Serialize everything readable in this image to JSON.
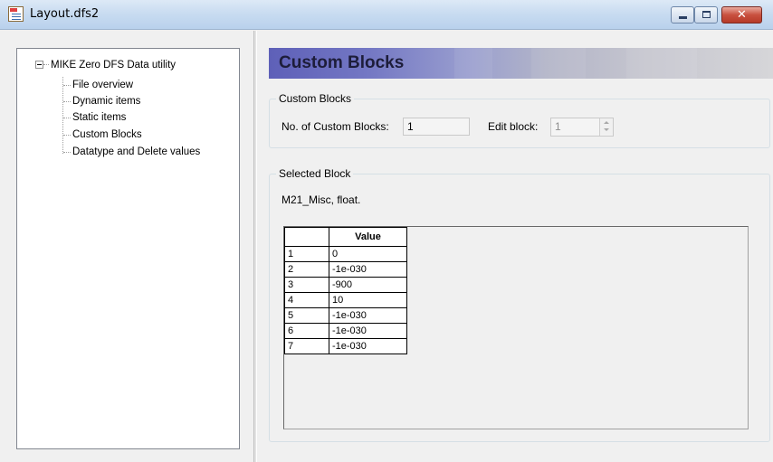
{
  "window": {
    "title": "Layout.dfs2",
    "close_glyph": "✕"
  },
  "tree": {
    "root_label": "MIKE Zero DFS Data utility",
    "items": [
      {
        "label": "File overview"
      },
      {
        "label": "Dynamic items"
      },
      {
        "label": "Static items"
      },
      {
        "label": "Custom Blocks"
      },
      {
        "label": "Datatype and Delete values"
      }
    ]
  },
  "header": {
    "title": "Custom Blocks"
  },
  "custom_blocks_group": {
    "legend": "Custom Blocks",
    "count_label": "No. of Custom Blocks:",
    "count_value": "1",
    "edit_label": "Edit block:",
    "edit_value": "1"
  },
  "selected_block_group": {
    "legend": "Selected Block",
    "description": "M21_Misc, float.",
    "table": {
      "column_header": "Value",
      "rows": [
        {
          "index": "1",
          "value": "0"
        },
        {
          "index": "2",
          "value": "-1e-030"
        },
        {
          "index": "3",
          "value": "-900"
        },
        {
          "index": "4",
          "value": "10"
        },
        {
          "index": "5",
          "value": "-1e-030"
        },
        {
          "index": "6",
          "value": "-1e-030"
        },
        {
          "index": "7",
          "value": "-1e-030"
        }
      ]
    }
  },
  "colors": {
    "titlebar": "#c9dcf1",
    "header_band_start": "#5e60b8",
    "close_button": "#c8503f",
    "window_bg": "#f0f0f0"
  }
}
